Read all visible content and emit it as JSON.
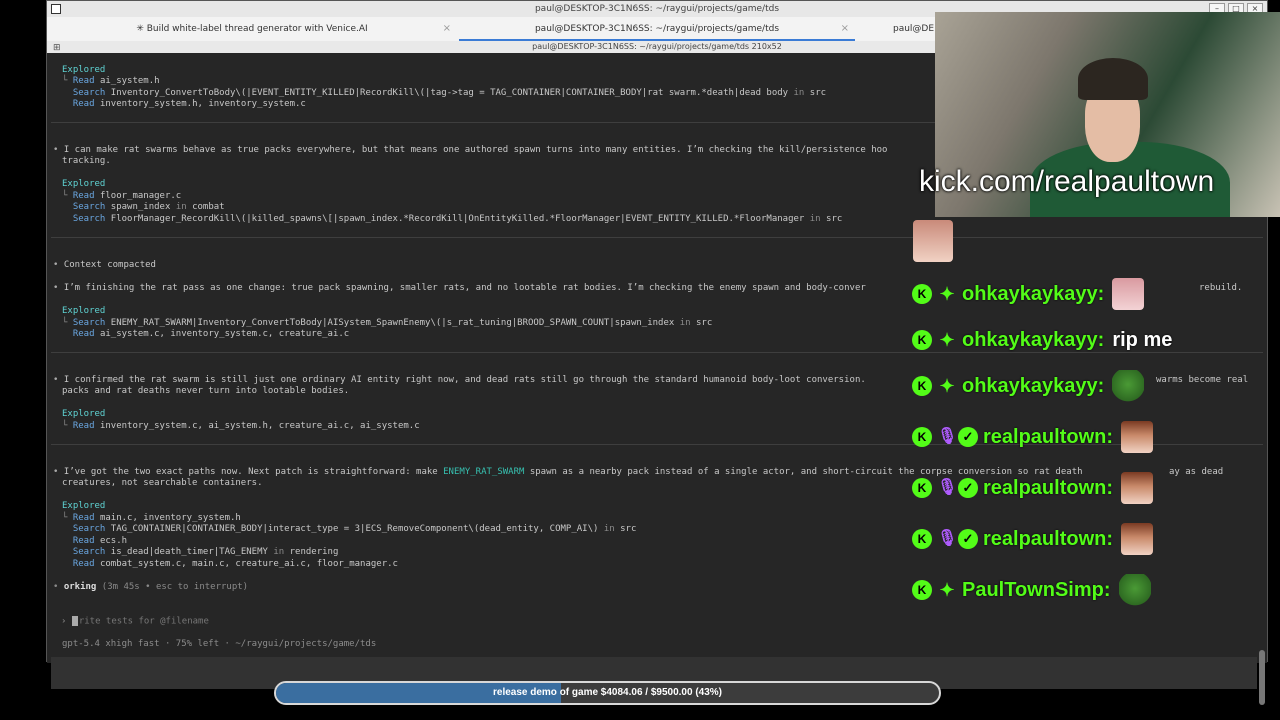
{
  "window": {
    "title": "paul@DESKTOP-3C1N6SS: ~/raygui/projects/game/tds",
    "subtitle": "paul@DESKTOP-3C1N6SS: ~/raygui/projects/game/tds 210x52",
    "tabs": [
      {
        "label": "✳ Build white-label thread generator with Venice.AI",
        "close": "×"
      },
      {
        "label": "paul@DESKTOP-3C1N6SS: ~/raygui/projects/game/tds",
        "close": "×"
      },
      {
        "label": "paul@DE"
      }
    ]
  },
  "terminal": {
    "block1": {
      "explored": "Explored",
      "r1_verb": "Read",
      "r1_arg": "ai_system.h",
      "r2_verb": "Search",
      "r2_arg": "Inventory_ConvertToBody\\(|EVENT_ENTITY_KILLED|RecordKill\\(|tag->tag = TAG_CONTAINER|CONTAINER_BODY|rat swarm.*death|dead body",
      "r2_in": "in",
      "r2_src": "src",
      "r3_verb": "Read",
      "r3_arg": "inventory_system.h, inventory_system.c"
    },
    "block2": {
      "msg1": "I can make rat swarms behave as true packs everywhere, but that means one authored spawn turns into many entities. I’m checking the kill/persistence hoo",
      "msg2": "tracking.",
      "explored": "Explored",
      "r1_verb": "Read",
      "r1_arg": "floor_manager.c",
      "r2_verb": "Search",
      "r2_arg": "spawn_index",
      "r2_in": "in",
      "r2_src": "combat",
      "r3_verb": "Search",
      "r3_arg": "FloorManager_RecordKill\\(|killed_spawns\\[|spawn_index.*RecordKill|OnEntityKilled.*FloorManager|EVENT_ENTITY_KILLED.*FloorManager",
      "r3_in": "in",
      "r3_src": "src"
    },
    "block3": {
      "compacted": "Context compacted",
      "msg1": "I’m finishing the rat pass as one change: true pack spawning, smaller rats, and no lootable rat bodies. I’m checking the enemy spawn and body-conver",
      "msg1_tail": "rebuild.",
      "explored": "Explored",
      "r1_verb": "Search",
      "r1_arg": "ENEMY_RAT_SWARM|Inventory_ConvertToBody|AISystem_SpawnEnemy\\(|s_rat_tuning|BROOD_SPAWN_COUNT|spawn_index",
      "r1_in": "in",
      "r1_src": "src",
      "r2_verb": "Read",
      "r2_arg": "ai_system.c, inventory_system.c, creature_ai.c"
    },
    "block4": {
      "msg1": "I confirmed the rat swarm is still just one ordinary AI entity right now, and dead rats still go through the standard humanoid body-loot conversion.",
      "msg1_tail": "warms become real",
      "msg2": "packs and rat deaths never turn into lootable bodies.",
      "explored": "Explored",
      "r1_verb": "Read",
      "r1_arg": "inventory_system.c, ai_system.h, creature_ai.c, ai_system.c"
    },
    "block5": {
      "msg1_a": "I’ve got the two exact paths now. Next patch is straightforward: make",
      "msg1_hl": "ENEMY_RAT_SWARM",
      "msg1_b": "spawn as a nearby pack instead of a single actor, and short-circuit the corpse conversion so rat death",
      "msg1_tail": "ay as dead",
      "msg2": "creatures, not searchable containers.",
      "explored": "Explored",
      "r1_verb": "Read",
      "r1_arg": "main.c, inventory_system.h",
      "r2_verb": "Search",
      "r2_arg": "TAG_CONTAINER|CONTAINER_BODY|interact_type = 3|ECS_RemoveComponent\\(dead_entity, COMP_AI\\)",
      "r2_in": "in",
      "r2_src": "src",
      "r3_verb": "Read",
      "r3_arg": "ecs.h",
      "r4_verb": "Search",
      "r4_arg": "is_dead|death_timer|TAG_ENEMY",
      "r4_in": "in",
      "r4_src": "rendering",
      "r5_verb": "Read",
      "r5_arg": "combat_system.c, main.c, creature_ai.c, floor_manager.c"
    },
    "working": {
      "prefix": "•",
      "label": "orking",
      "detail": "(3m 45s • esc to interrupt)"
    },
    "prompt": {
      "arrow": "›",
      "placeholder": "rite tests for @filename"
    },
    "status": "gpt-5.4 xhigh fast · 75% left · ~/raygui/projects/game/tds"
  },
  "overlay": {
    "kick_url": "kick.com/realpaultown",
    "chat": [
      {
        "user": "ohkaykaykayy:",
        "msg": "",
        "emote": "pink",
        "badges": [
          "kick",
          "gift"
        ]
      },
      {
        "user": "ohkaykaykayy:",
        "msg": "rip me",
        "emote": "",
        "badges": [
          "kick",
          "gift"
        ]
      },
      {
        "user": "ohkaykaykayy:",
        "msg": "",
        "emote": "pepe",
        "badges": [
          "kick",
          "gift"
        ]
      },
      {
        "user": "realpaultown:",
        "msg": "",
        "emote": "anime",
        "badges": [
          "kick",
          "mic",
          "verified"
        ]
      },
      {
        "user": "realpaultown:",
        "msg": "",
        "emote": "anime",
        "badges": [
          "kick",
          "mic",
          "verified"
        ]
      },
      {
        "user": "realpaultown:",
        "msg": "",
        "emote": "anime",
        "badges": [
          "kick",
          "mic",
          "verified"
        ]
      },
      {
        "user": "PaulTownSimp:",
        "msg": "",
        "emote": "pepe",
        "badges": [
          "kick",
          "gift"
        ]
      }
    ],
    "progress": {
      "label": "release demo of game $4084.06 / $9500.00 (43%)",
      "fraction": 0.43,
      "color": "#3a6ea0"
    }
  },
  "colors": {
    "kick_green": "#53fc18",
    "terminal_bg": "#262626",
    "path_blue": "#6aa6e0"
  }
}
